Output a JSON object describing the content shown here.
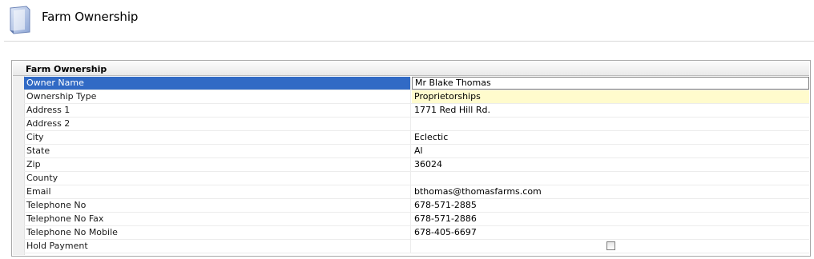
{
  "page": {
    "title": "Farm Ownership",
    "icon": "document-icon"
  },
  "grid": {
    "caption": "Farm Ownership",
    "rows": [
      {
        "label": "Owner Name",
        "value": "Mr Blake Thomas"
      },
      {
        "label": "Ownership Type",
        "value": "Proprietorships"
      },
      {
        "label": "Address 1",
        "value": "1771 Red Hill Rd."
      },
      {
        "label": "Address 2",
        "value": ""
      },
      {
        "label": "City",
        "value": "Eclectic"
      },
      {
        "label": "State",
        "value": "Al"
      },
      {
        "label": "Zip",
        "value": "36024"
      },
      {
        "label": "County",
        "value": ""
      },
      {
        "label": "Email",
        "value": "bthomas@thomasfarms.com"
      },
      {
        "label": "Telephone No",
        "value": "678-571-2885"
      },
      {
        "label": "Telephone No Fax",
        "value": "678-571-2886"
      },
      {
        "label": "Telephone No Mobile",
        "value": "678-405-6697"
      },
      {
        "label": "Hold Payment",
        "checked": false
      }
    ]
  },
  "colors": {
    "selection": "#316ac5",
    "highlight": "#fffbcd"
  }
}
